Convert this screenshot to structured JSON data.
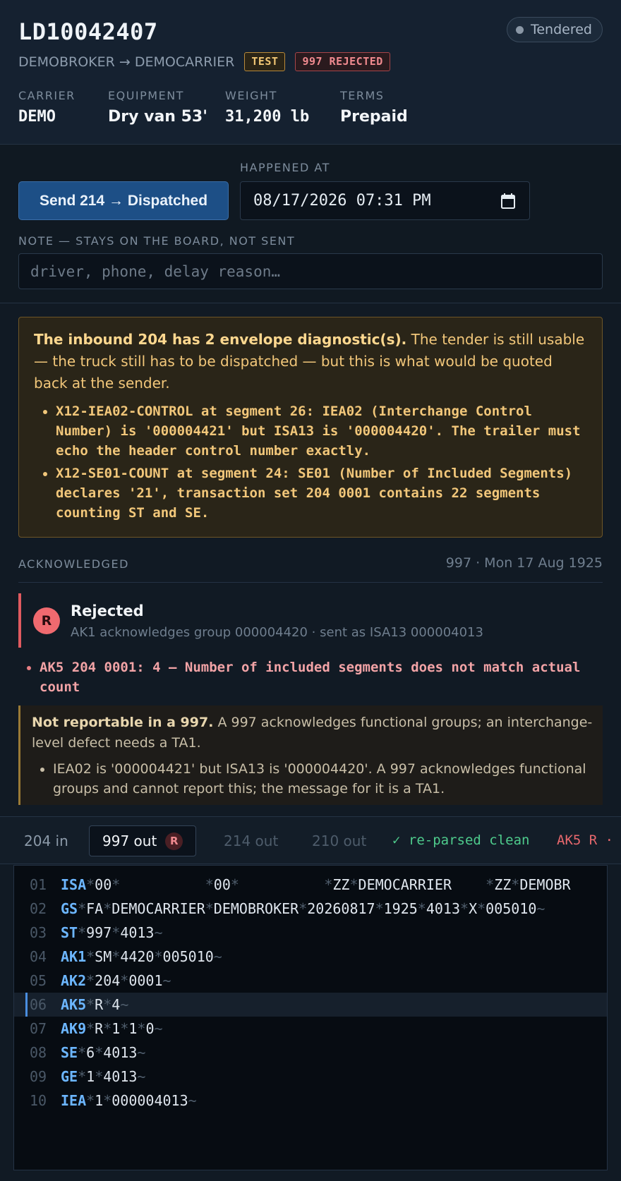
{
  "load": {
    "id": "LD10042407",
    "status": "Tendered",
    "route": "DEMOBROKER → DEMOCARRIER",
    "badges": {
      "test": "TEST",
      "rejected": "997 REJECTED"
    },
    "meta": [
      {
        "label": "CARRIER",
        "value": "DEMO"
      },
      {
        "label": "EQUIPMENT",
        "value": "Dry van 53'"
      },
      {
        "label": "WEIGHT",
        "value": "31,200 lb"
      },
      {
        "label": "TERMS",
        "value": "Prepaid"
      }
    ]
  },
  "actions": {
    "send_label": "Send 214 → Dispatched",
    "happened_at_label": "HAPPENED AT",
    "happened_at_value": "08/17/2026 07:31 PM",
    "note_label": "NOTE — STAYS ON THE BOARD, NOT SENT",
    "note_placeholder": "driver, phone, delay reason…"
  },
  "diagnostics": {
    "intro_bold": "The inbound 204 has 2 envelope diagnostic(s).",
    "intro_rest": " The tender is still usable — the truck still has to be dispatched — but this is what would be quoted back at the sender.",
    "items": [
      "X12-IEA02-CONTROL at segment 26: IEA02 (Interchange Control Number) is '000004421' but ISA13 is '000004420'. The trailer must echo the header control number exactly.",
      "X12-SE01-COUNT at segment 24: SE01 (Number of Included Segments) declares '21', transaction set 204 0001 contains 22 segments counting ST and SE."
    ]
  },
  "acknowledged": {
    "title": "ACKNOWLEDGED",
    "meta": "997 · Mon 17 Aug 1925",
    "status_icon": "R",
    "status_title": "Rejected",
    "status_sub": "AK1 acknowledges group 000004420 · sent as ISA13 000004013",
    "errors": [
      "AK5 204 0001: 4 — Number of included segments does not match actual count"
    ],
    "not_reportable": {
      "bold": "Not reportable in a 997.",
      "rest": " A 997 acknowledges functional groups; an interchange-level defect needs a TA1.",
      "items": [
        "IEA02 is '000004421' but ISA13 is '000004420'. A 997 acknowledges functional groups and cannot report this; the message for it is a TA1."
      ]
    }
  },
  "tabs": {
    "items": [
      {
        "label": "204 in"
      },
      {
        "label": "997 out",
        "badge": "R"
      },
      {
        "label": "214 out"
      },
      {
        "label": "210 out"
      }
    ],
    "reparsed": "✓ re-parsed clean",
    "ak5": "AK5 R ·"
  },
  "code_lines": [
    {
      "n": "01",
      "seg": "ISA",
      "rest": [
        "00",
        "          ",
        "00",
        "          ",
        "ZZ",
        "DEMOCARRIER    ",
        "ZZ",
        "DEMOBR"
      ],
      "tilde": false
    },
    {
      "n": "02",
      "seg": "GS",
      "rest": [
        "FA",
        "DEMOCARRIER",
        "DEMOBROKER",
        "20260817",
        "1925",
        "4013",
        "X",
        "005010"
      ],
      "tilde": true
    },
    {
      "n": "03",
      "seg": "ST",
      "rest": [
        "997",
        "4013"
      ],
      "tilde": true
    },
    {
      "n": "04",
      "seg": "AK1",
      "rest": [
        "SM",
        "4420",
        "005010"
      ],
      "tilde": true
    },
    {
      "n": "05",
      "seg": "AK2",
      "rest": [
        "204",
        "0001"
      ],
      "tilde": true
    },
    {
      "n": "06",
      "seg": "AK5",
      "rest": [
        "R",
        "4"
      ],
      "tilde": true,
      "highlight": true
    },
    {
      "n": "07",
      "seg": "AK9",
      "rest": [
        "R",
        "1",
        "1",
        "0"
      ],
      "tilde": true
    },
    {
      "n": "08",
      "seg": "SE",
      "rest": [
        "6",
        "4013"
      ],
      "tilde": true
    },
    {
      "n": "09",
      "seg": "GE",
      "rest": [
        "1",
        "4013"
      ],
      "tilde": true
    },
    {
      "n": "10",
      "seg": "IEA",
      "rest": [
        "1",
        "000004013"
      ],
      "tilde": true
    }
  ],
  "colors": {
    "accent": "#1d4f86",
    "warning": "#f2c77a",
    "error": "#f06a6f",
    "success": "#4ecb8c",
    "segment": "#6cb6ff"
  }
}
